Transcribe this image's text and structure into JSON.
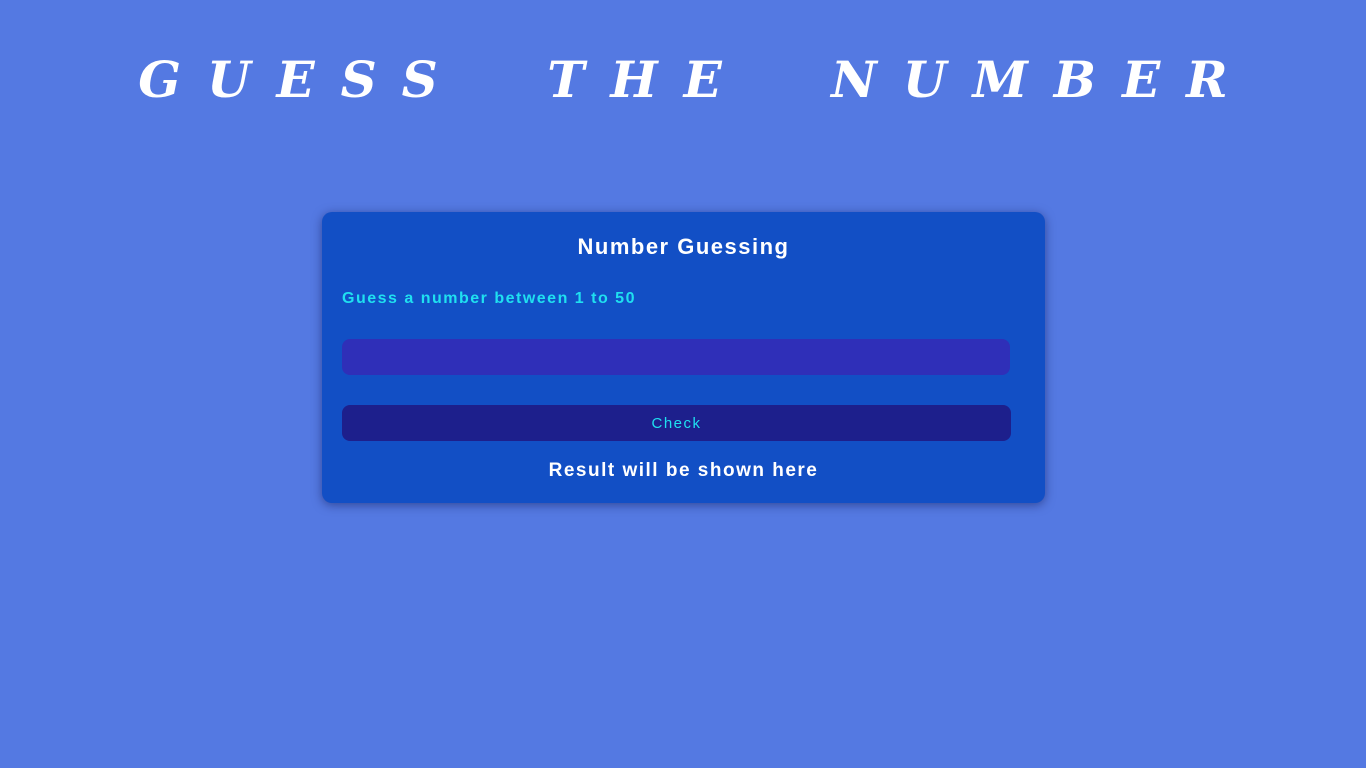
{
  "header": {
    "title": "GUESS THE NUMBER"
  },
  "card": {
    "title": "Number Guessing",
    "prompt": "Guess a number between 1 to 50",
    "input": {
      "value": "",
      "placeholder": ""
    },
    "check_label": "Check",
    "result": "Result will be shown here"
  },
  "colors": {
    "page_background": "#5479e2",
    "card_background": "#124fc5",
    "input_background": "#2f2fb8",
    "button_background": "#1d1f8c",
    "accent_cyan": "#1fe0f0",
    "text_white": "#ffffff"
  }
}
